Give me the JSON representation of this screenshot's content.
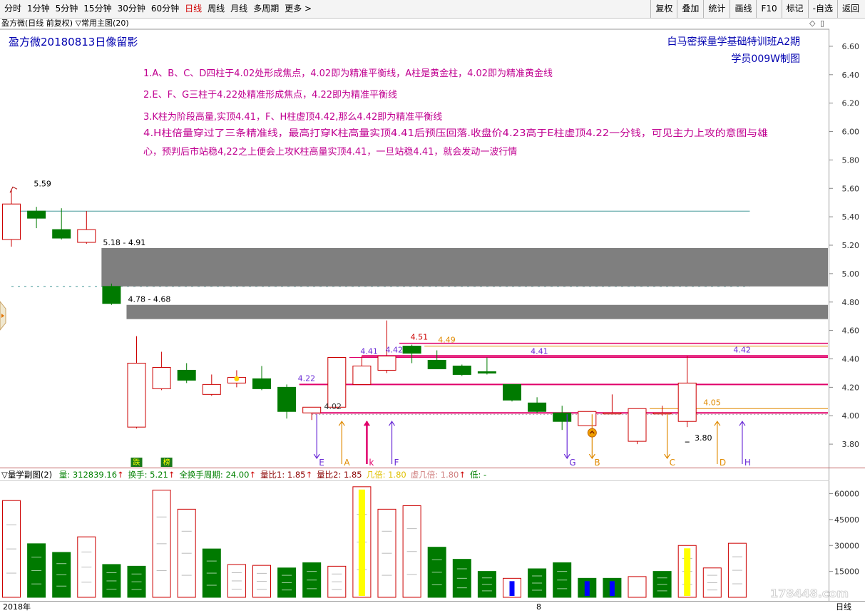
{
  "toolbar": {
    "periods": [
      "分时",
      "1分钟",
      "5分钟",
      "15分钟",
      "30分钟",
      "60分钟",
      "日线",
      "周线",
      "月线",
      "多周期",
      "更多 >"
    ],
    "active_index": 6,
    "buttons": [
      "复权",
      "叠加",
      "统计",
      "画线",
      "F10",
      "标记",
      "-自选",
      "返回"
    ]
  },
  "title_bar": {
    "main_title": "盈方微(日线 前复权) ▽常用主图(20)",
    "controls": [
      "◇",
      "▯"
    ]
  },
  "annotation": {
    "chart_title": "盈方微20180813日像留影",
    "brand_line1": "白马密探量学基础特训班A2期",
    "brand_line2": "学员009W制图",
    "notes": [
      "1.A、B、C、D四柱于4.02处形成焦点，4.02即为精准平衡线，A柱是黄金柱，4.02即为精准黄金线",
      "2.E、F、G三柱于4.22处精准形成焦点，4.22即为精准平衡线",
      "3.K柱为阶段高量,实顶4.41，F、H柱虚顶4.42,那么4.42即为精准平衡线",
      "4.H柱倍量穿过了三条精准线，最高打穿K柱高量实顶4.41后预压回落.收盘价4.23高于E柱虚顶4.22一分钱，可见主力上攻的意图与雄",
      "心，预判后市站稳4,22之上便会上攻K柱高量实顶4.41，一旦站稳4.41，就会发动一波行情"
    ]
  },
  "sub_indicator": {
    "name": "▽量学副图(2)",
    "fields": [
      {
        "label": "量: 312839.16",
        "arrow": "↑",
        "color": "#008000"
      },
      {
        "label": "换手: 5.21",
        "arrow": "↑",
        "color": "#008000"
      },
      {
        "label": "全换手周期: 24.00",
        "arrow": "↑",
        "color": "#008000"
      },
      {
        "label": "量比1: 1.85",
        "arrow": "↑",
        "color": "#8b0000"
      },
      {
        "label": "量比2: 1.85",
        "arrow": "",
        "color": "#8b0000"
      },
      {
        "label": "几倍: 1.80",
        "arrow": "",
        "color": "#e0c000"
      },
      {
        "label": "虚几倍: 1.80",
        "arrow": "↑",
        "color": "#d08080"
      },
      {
        "label": "低: -",
        "arrow": "",
        "color": "#008000"
      }
    ]
  },
  "bottom": {
    "year_label": "2018年",
    "month_label": "8",
    "period_label": "日线"
  },
  "watermark": "178448.com",
  "colors": {
    "up": "#cc0000",
    "down": "#007a00",
    "pink_line": "#e0006a",
    "purple": "#6a2bd6",
    "orange": "#e08a00",
    "gray_zone": "#7f7f7f",
    "text_magenta": "#c00090",
    "title_blue": "#0000b0"
  },
  "chart_data": [
    {
      "type": "candlestick",
      "y_axis_ticks": [
        3.8,
        4.0,
        4.2,
        4.4,
        4.6,
        4.8,
        5.0,
        5.2,
        5.4,
        5.6,
        5.8,
        6.0,
        6.2,
        6.4,
        6.6
      ],
      "ylim": [
        3.64,
        6.72
      ],
      "candles": [
        {
          "o": 5.24,
          "h": 5.59,
          "l": 5.19,
          "c": 5.49
        },
        {
          "o": 5.44,
          "h": 5.47,
          "l": 5.32,
          "c": 5.39
        },
        {
          "o": 5.31,
          "h": 5.46,
          "l": 5.24,
          "c": 5.25
        },
        {
          "o": 5.22,
          "h": 5.44,
          "l": 5.21,
          "c": 5.31
        },
        {
          "o": 4.91,
          "h": 4.93,
          "l": 4.78,
          "c": 4.79
        },
        {
          "o": 3.92,
          "h": 4.56,
          "l": 3.91,
          "c": 4.37
        },
        {
          "o": 4.19,
          "h": 4.45,
          "l": 4.18,
          "c": 4.34
        },
        {
          "o": 4.32,
          "h": 4.37,
          "l": 4.23,
          "c": 4.25
        },
        {
          "o": 4.15,
          "h": 4.29,
          "l": 4.14,
          "c": 4.22
        },
        {
          "o": 4.23,
          "h": 4.32,
          "l": 4.2,
          "c": 4.27
        },
        {
          "o": 4.26,
          "h": 4.35,
          "l": 4.18,
          "c": 4.19
        },
        {
          "o": 4.2,
          "h": 4.22,
          "l": 3.98,
          "c": 4.03
        },
        {
          "o": 4.02,
          "h": 4.06,
          "l": 3.97,
          "c": 4.06
        },
        {
          "o": 4.06,
          "h": 4.41,
          "l": 4.05,
          "c": 4.41
        },
        {
          "o": 4.22,
          "h": 4.42,
          "l": 4.22,
          "c": 4.35
        },
        {
          "o": 4.32,
          "h": 4.67,
          "l": 4.3,
          "c": 4.42
        },
        {
          "o": 4.49,
          "h": 4.5,
          "l": 4.37,
          "c": 4.44
        },
        {
          "o": 4.39,
          "h": 4.46,
          "l": 4.33,
          "c": 4.33
        },
        {
          "o": 4.35,
          "h": 4.36,
          "l": 4.28,
          "c": 4.29
        },
        {
          "o": 4.31,
          "h": 4.41,
          "l": 4.29,
          "c": 4.3
        },
        {
          "o": 4.22,
          "h": 4.22,
          "l": 4.1,
          "c": 4.11
        },
        {
          "o": 4.09,
          "h": 4.13,
          "l": 4.02,
          "c": 4.03
        },
        {
          "o": 4.02,
          "h": 4.07,
          "l": 3.9,
          "c": 3.96
        },
        {
          "o": 3.93,
          "h": 4.03,
          "l": 3.93,
          "c": 4.03
        },
        {
          "o": 4.02,
          "h": 4.15,
          "l": 4.01,
          "c": 4.02
        },
        {
          "o": 3.82,
          "h": 4.05,
          "l": 3.8,
          "c": 4.05
        },
        {
          "o": 4.02,
          "h": 4.07,
          "l": 4.0,
          "c": 4.02
        },
        {
          "o": 3.96,
          "h": 4.42,
          "l": 3.92,
          "c": 4.23
        }
      ],
      "gap_zones": [
        {
          "from_index": 3.6,
          "high": 5.18,
          "low": 4.91,
          "label": "5.18 - 4.91"
        },
        {
          "from_index": 4.6,
          "high": 4.78,
          "low": 4.68,
          "label": "4.78 - 4.68"
        }
      ],
      "reference_lines": [
        {
          "y": 5.44,
          "color": "#2a8a8a",
          "from_index": 0,
          "to_index": 29.5,
          "width": 0.8,
          "dash": ""
        },
        {
          "y": 4.51,
          "color": "#e0006a",
          "from_index": 15.5,
          "to_index": 33,
          "width": 1.5,
          "dash": ""
        },
        {
          "y": 4.49,
          "color": "#e08a00",
          "from_index": 16.5,
          "to_index": 33,
          "width": 1,
          "dash": ""
        },
        {
          "y": 4.42,
          "color": "#e0006a",
          "from_index": 14,
          "to_index": 33,
          "width": 2.5,
          "dash": ""
        },
        {
          "y": 4.41,
          "color": "#e0006a",
          "from_index": 13.5,
          "to_index": 33,
          "width": 1,
          "dash": ""
        },
        {
          "y": 4.22,
          "color": "#e0006a",
          "from_index": 11.5,
          "to_index": 33,
          "width": 2,
          "dash": ""
        },
        {
          "y": 4.05,
          "color": "#e08a00",
          "from_index": 25.5,
          "to_index": 33,
          "width": 1,
          "dash": ""
        },
        {
          "y": 4.02,
          "color": "#e0006a",
          "from_index": 12,
          "to_index": 33,
          "width": 2,
          "dash": ""
        },
        {
          "y": 4.01,
          "color": "#8a8a8a",
          "from_index": 12,
          "to_index": 33,
          "width": 0.8,
          "dash": "2,3"
        },
        {
          "y": 4.91,
          "color": "#2a8a8a",
          "from_index": 0,
          "to_index": 29.5,
          "width": 0.8,
          "dash": "3,6"
        }
      ],
      "price_labels": [
        {
          "index": 0.95,
          "y": 5.59,
          "text": "5.59",
          "color": "#000"
        },
        {
          "index": 11.5,
          "y": 4.22,
          "text": "4.22",
          "color": "#6a2bd6"
        },
        {
          "index": 12.55,
          "y": 4.02,
          "text": "4.02",
          "color": "#333"
        },
        {
          "index": 14.0,
          "y": 4.41,
          "text": "4.41",
          "color": "#6a2bd6"
        },
        {
          "index": 15.0,
          "y": 4.42,
          "text": "4.42",
          "color": "#6a2bd6"
        },
        {
          "index": 16.0,
          "y": 4.51,
          "text": "4.51",
          "color": "#cc0000"
        },
        {
          "index": 17.1,
          "y": 4.49,
          "text": "4.49",
          "color": "#e08a00"
        },
        {
          "index": 20.8,
          "y": 4.41,
          "text": "4.41",
          "color": "#6a2bd6"
        },
        {
          "index": 27.7,
          "y": 4.05,
          "text": "4.05",
          "color": "#e08a00"
        },
        {
          "index": 27.35,
          "y": 3.8,
          "text": "3.80",
          "color": "#000"
        },
        {
          "index": 28.9,
          "y": 4.42,
          "text": "4.42",
          "color": "#6a2bd6"
        }
      ],
      "arrows": [
        {
          "index": 12.2,
          "label": "E",
          "color": "#6a2bd6",
          "dir": "down"
        },
        {
          "index": 13.2,
          "label": "A",
          "color": "#e08a00",
          "dir": "up"
        },
        {
          "index": 14.2,
          "label": "k",
          "color": "#e0006a",
          "dir": "up"
        },
        {
          "index": 15.2,
          "label": "F",
          "color": "#6a2bd6",
          "dir": "up"
        },
        {
          "index": 22.2,
          "label": "G",
          "color": "#6a2bd6",
          "dir": "down"
        },
        {
          "index": 23.2,
          "label": "B",
          "color": "#e08a00",
          "dir": "down"
        },
        {
          "index": 26.2,
          "label": "C",
          "color": "#e08a00",
          "dir": "down"
        },
        {
          "index": 28.2,
          "label": "D",
          "color": "#e08a00",
          "dir": "up"
        },
        {
          "index": 29.2,
          "label": "H",
          "color": "#6a2bd6",
          "dir": "up"
        }
      ],
      "badges": [
        {
          "index": 5.0,
          "text": "跌"
        },
        {
          "index": 6.2,
          "text": "榜"
        }
      ]
    },
    {
      "type": "bar",
      "y_axis_ticks": [
        15000,
        30000,
        45000,
        60000
      ],
      "ylim": [
        0,
        66000
      ],
      "volumes": [
        {
          "v": 56000,
          "up": true,
          "fill": ""
        },
        {
          "v": 31000,
          "up": false,
          "fill": ""
        },
        {
          "v": 26000,
          "up": false,
          "fill": ""
        },
        {
          "v": 35000,
          "up": true,
          "fill": ""
        },
        {
          "v": 19000,
          "up": false,
          "fill": ""
        },
        {
          "v": 18000,
          "up": false,
          "fill": ""
        },
        {
          "v": 62000,
          "up": true,
          "fill": ""
        },
        {
          "v": 51000,
          "up": true,
          "fill": ""
        },
        {
          "v": 28000,
          "up": false,
          "fill": ""
        },
        {
          "v": 19000,
          "up": true,
          "fill": ""
        },
        {
          "v": 18500,
          "up": true,
          "fill": ""
        },
        {
          "v": 17000,
          "up": false,
          "fill": ""
        },
        {
          "v": 20000,
          "up": false,
          "fill": ""
        },
        {
          "v": 18000,
          "up": true,
          "fill": ""
        },
        {
          "v": 64000,
          "up": true,
          "fill": "#ffff00"
        },
        {
          "v": 51000,
          "up": true,
          "fill": ""
        },
        {
          "v": 53000,
          "up": true,
          "fill": ""
        },
        {
          "v": 29000,
          "up": false,
          "fill": ""
        },
        {
          "v": 22000,
          "up": false,
          "fill": ""
        },
        {
          "v": 15000,
          "up": false,
          "fill": ""
        },
        {
          "v": 11000,
          "up": true,
          "fill": "#0000ff"
        },
        {
          "v": 16500,
          "up": false,
          "fill": ""
        },
        {
          "v": 20000,
          "up": false,
          "fill": ""
        },
        {
          "v": 11000,
          "up": false,
          "fill": "#0000ff"
        },
        {
          "v": 11000,
          "up": false,
          "fill": "#0000ff"
        },
        {
          "v": 12000,
          "up": true,
          "fill": ""
        },
        {
          "v": 15000,
          "up": false,
          "fill": ""
        },
        {
          "v": 30000,
          "up": true,
          "fill": "#ffff00"
        },
        {
          "v": 17000,
          "up": true,
          "fill": ""
        },
        {
          "v": 31283.916,
          "up": true,
          "fill": ""
        }
      ]
    }
  ]
}
